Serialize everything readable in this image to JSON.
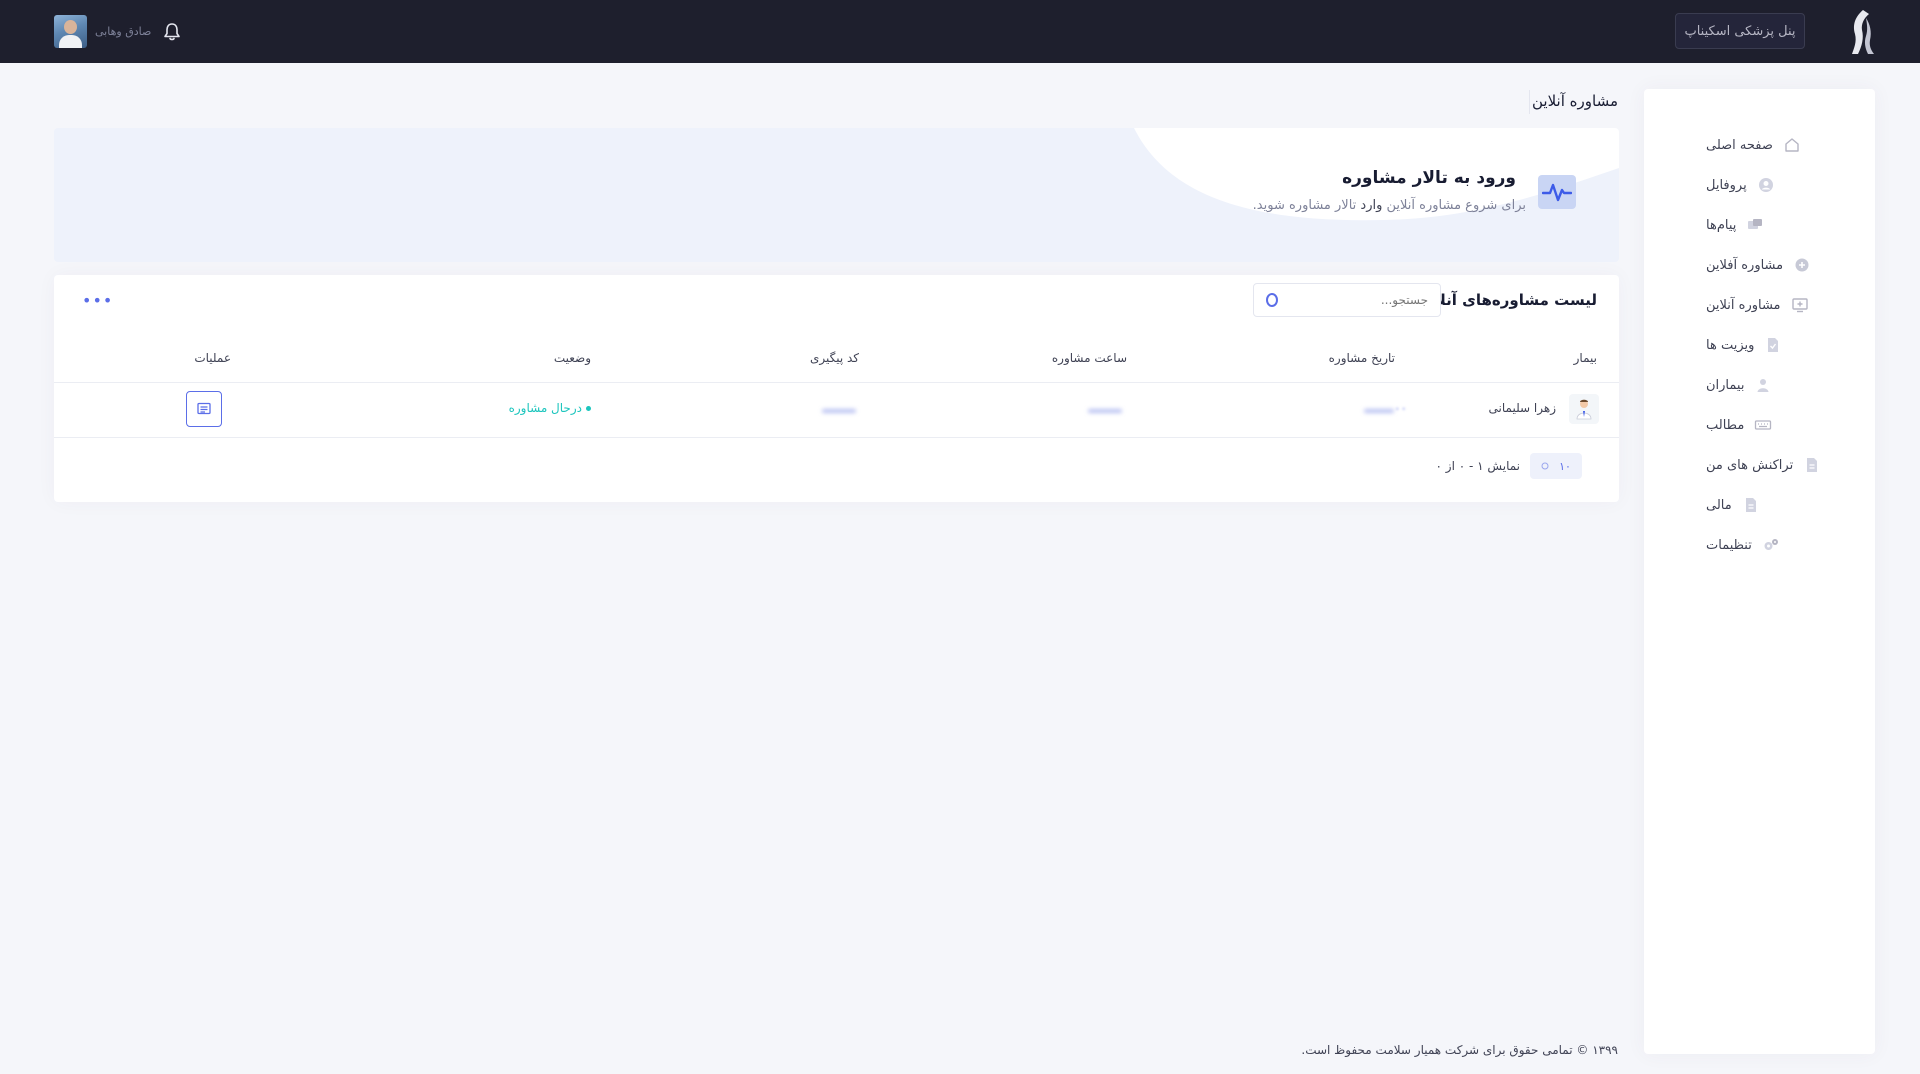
{
  "header": {
    "panel_button": "پنل پزشکی اسکیناپ",
    "user_name": "صادق وهابی"
  },
  "sidebar": {
    "items": [
      {
        "label": "صفحه اصلی",
        "icon": "home-icon"
      },
      {
        "label": "پروفایل",
        "icon": "user-circle-icon"
      },
      {
        "label": "پیام‌ها",
        "icon": "messages-icon"
      },
      {
        "label": "مشاوره آفلاین",
        "icon": "chat-plus-icon"
      },
      {
        "label": "مشاوره آنلاین",
        "icon": "monitor-plus-icon"
      },
      {
        "label": "ویزیت ها",
        "icon": "document-check-icon"
      },
      {
        "label": "بیماران",
        "icon": "patient-icon"
      },
      {
        "label": "مطالب",
        "icon": "keyboard-icon"
      },
      {
        "label": "تراکنش های من",
        "icon": "file-icon"
      },
      {
        "label": "مالی",
        "icon": "file-icon"
      },
      {
        "label": "تنظیمات",
        "icon": "gears-icon"
      }
    ]
  },
  "page": {
    "title": "مشاوره آنلاین"
  },
  "banner": {
    "title": "ورود به تالار مشاوره",
    "subtitle_before": "برای شروع مشاوره آنلاین",
    "subtitle_bold": "وارد",
    "subtitle_after": "تالار مشاوره شوید."
  },
  "list": {
    "title": "لیست مشاوره‌های آنلاین",
    "search_placeholder": "جستجو...",
    "columns": [
      "بیمار",
      "تاریخ مشاوره",
      "ساعت مشاوره",
      "کد پیگیری",
      "وضعیت",
      "عملیات"
    ],
    "rows": [
      {
        "patient": "زهرا سلیمانی",
        "date_partial": "۰۰",
        "status": "درحال مشاوره"
      }
    ],
    "per_page": "۱۰",
    "pagination_info": "نمایش ۱ - ۰ از ۰"
  },
  "footer": {
    "text": "۱۳۹۹ © تمامی حقوق برای شرکت همیار سلامت محفوظ است."
  },
  "colors": {
    "topbar": "#1e1f2d",
    "accent": "#5b6ee8",
    "status_green": "#1bc5bd",
    "banner_bg": "#eef2fb"
  }
}
